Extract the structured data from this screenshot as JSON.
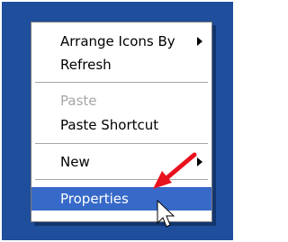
{
  "menu": {
    "items": [
      {
        "label": "Arrange Icons By",
        "submenu": true,
        "enabled": true
      },
      {
        "label": "Refresh",
        "enabled": true
      },
      {
        "label": "Paste",
        "enabled": false
      },
      {
        "label": "Paste Shortcut",
        "enabled": true
      },
      {
        "label": "New",
        "submenu": true,
        "enabled": true
      },
      {
        "label": "Properties",
        "enabled": true,
        "selected": true
      }
    ]
  },
  "colors": {
    "desktop": "#1f4e9c",
    "highlight": "#3769c8",
    "annotation_arrow": "#e8121e"
  },
  "icons": [
    "submenu-arrow-icon",
    "red-annotation-arrow-icon",
    "mouse-pointer-icon"
  ]
}
